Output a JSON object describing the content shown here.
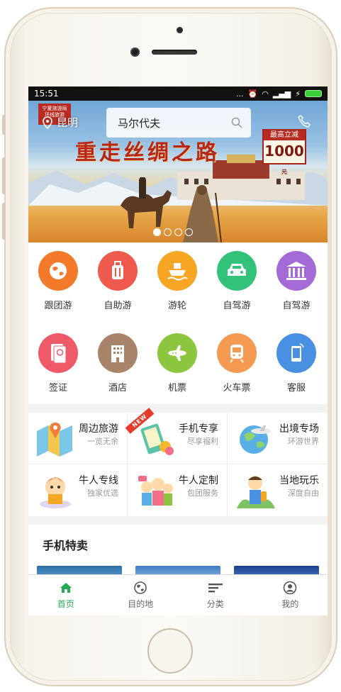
{
  "status_bar": {
    "time": "15:51",
    "signal_text": "..."
  },
  "banner": {
    "org_label": "宁夏旅游局\n环线旅游",
    "title": "重走丝绸之路",
    "promo_top": "最高立减",
    "promo_amount": "1000",
    "promo_unit": "元",
    "slide_count": 4,
    "active_slide": 0
  },
  "header": {
    "city": "昆明",
    "search_placeholder": "马尔代夫"
  },
  "categories": [
    {
      "label": "跟团游",
      "icon": "globe-icon",
      "color": "#f27a2a"
    },
    {
      "label": "自助游",
      "icon": "luggage-icon",
      "color": "#ef5a4f"
    },
    {
      "label": "游轮",
      "icon": "ship-icon",
      "color": "#f6a623"
    },
    {
      "label": "自驾游",
      "icon": "car-icon",
      "color": "#33c27a"
    },
    {
      "label": "自驾游",
      "icon": "temple-icon",
      "color": "#a46bd6"
    },
    {
      "label": "签证",
      "icon": "passport-icon",
      "color": "#ef5a69"
    },
    {
      "label": "酒店",
      "icon": "hotel-icon",
      "color": "#a9846a"
    },
    {
      "label": "机票",
      "icon": "plane-icon",
      "color": "#8cc63f"
    },
    {
      "label": "火车票",
      "icon": "train-icon",
      "color": "#f59a52"
    },
    {
      "label": "客服",
      "icon": "phone-service-icon",
      "color": "#4a90e2"
    }
  ],
  "features": [
    {
      "title": "周边旅游",
      "subtitle": "一览无余"
    },
    {
      "title": "手机专享",
      "subtitle": "尽享福利",
      "badge": "NEW"
    },
    {
      "title": "出境专场",
      "subtitle": "环游世界"
    },
    {
      "title": "牛人专线",
      "subtitle": "独家优选"
    },
    {
      "title": "牛人定制",
      "subtitle": "包团服务"
    },
    {
      "title": "当地玩乐",
      "subtitle": "深度自由"
    }
  ],
  "specials": {
    "title": "手机特卖"
  },
  "tabs": [
    {
      "label": "首页",
      "icon": "home-icon",
      "active": true
    },
    {
      "label": "目的地",
      "icon": "globe-tab-icon",
      "active": false
    },
    {
      "label": "分类",
      "icon": "list-icon",
      "active": false
    },
    {
      "label": "我的",
      "icon": "user-icon",
      "active": false
    }
  ],
  "colors": {
    "accent": "#22aa55"
  }
}
